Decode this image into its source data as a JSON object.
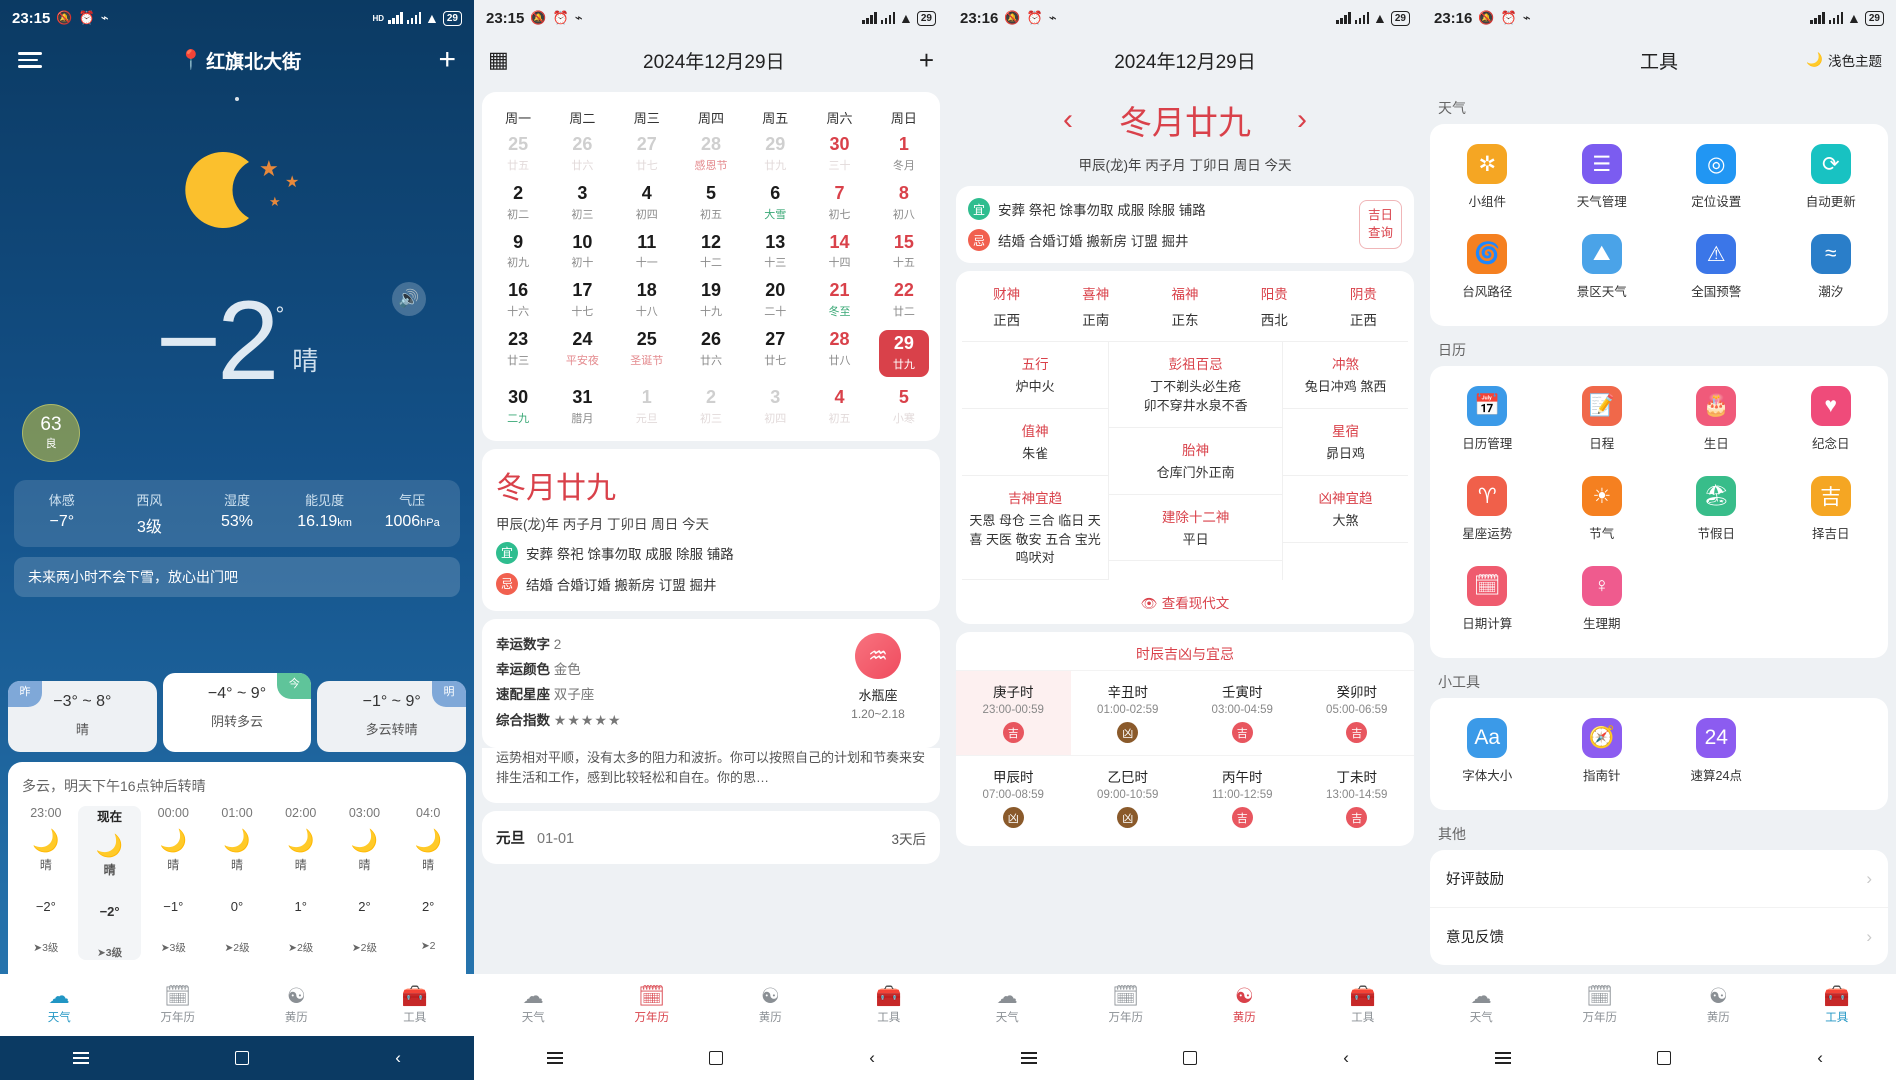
{
  "status_bars": [
    {
      "time": "23:15",
      "icons": [
        "mute-icon",
        "alarm-icon",
        "nfc-icon"
      ],
      "signal": "HD",
      "battery": "29"
    },
    {
      "time": "23:15",
      "icons": [
        "mute-icon",
        "alarm-icon",
        "nfc-icon"
      ],
      "signal": "HD",
      "battery": "29"
    },
    {
      "time": "23:16",
      "icons": [
        "mute-icon",
        "alarm-icon",
        "nfc-icon"
      ],
      "signal": "HD",
      "battery": "29"
    },
    {
      "time": "23:16",
      "icons": [
        "mute-icon",
        "alarm-icon",
        "nfc-icon"
      ],
      "signal": "HD",
      "battery": "29"
    }
  ],
  "weather": {
    "city": "红旗北大街",
    "temp": "−2",
    "degree": "°",
    "condition": "晴",
    "aqi_value": "63",
    "aqi_level": "良",
    "metrics": [
      {
        "key": "体感",
        "value": "−7°"
      },
      {
        "key": "西风",
        "value": "3级"
      },
      {
        "key": "湿度",
        "value": "53%"
      },
      {
        "key": "能见度",
        "value": "16.19",
        "unit": "km"
      },
      {
        "key": "气压",
        "value": "1006",
        "unit": "hPa"
      }
    ],
    "tip": "未来两小时不会下雪，放心出门吧",
    "days": [
      {
        "badge": "昨",
        "badge_color": "#7fa8d8",
        "range": "−3° ~ 8°",
        "desc": "晴",
        "today": false
      },
      {
        "badge": "今",
        "badge_color": "#5fc49a",
        "range": "−4° ~ 9°",
        "desc": "阴转多云",
        "today": true
      },
      {
        "badge": "明",
        "badge_color": "#7fa8d8",
        "range": "−1° ~ 9°",
        "desc": "多云转晴",
        "today": false
      }
    ],
    "hourly_summary": "多云，明天下午16点钟后转晴",
    "hours": [
      {
        "time": "23:00",
        "icon": "moon-icon",
        "desc": "晴",
        "temp": "−2°",
        "wind": "➤3级",
        "now": false
      },
      {
        "time": "现在",
        "icon": "moon-icon",
        "desc": "晴",
        "temp": "−2°",
        "wind": "➤3级",
        "now": true
      },
      {
        "time": "00:00",
        "icon": "moon-icon",
        "desc": "晴",
        "temp": "−1°",
        "wind": "➤3级",
        "now": false
      },
      {
        "time": "01:00",
        "icon": "moon-icon",
        "desc": "晴",
        "temp": "0°",
        "wind": "➤2级",
        "now": false
      },
      {
        "time": "02:00",
        "icon": "moon-icon",
        "desc": "晴",
        "temp": "1°",
        "wind": "➤2级",
        "now": false
      },
      {
        "time": "03:00",
        "icon": "moon-icon",
        "desc": "晴",
        "temp": "2°",
        "wind": "➤2级",
        "now": false
      },
      {
        "time": "04:0",
        "icon": "moon-icon",
        "desc": "晴",
        "temp": "2°",
        "wind": "➤2",
        "now": false
      }
    ]
  },
  "calendar": {
    "title": "2024年12月29日",
    "weekdays": [
      "周一",
      "周二",
      "周三",
      "周四",
      "周五",
      "周六",
      "周日"
    ],
    "weeks": [
      [
        {
          "d": "25",
          "l": "廿五",
          "dim": true
        },
        {
          "d": "26",
          "l": "廿六",
          "dim": true
        },
        {
          "d": "27",
          "l": "廿七",
          "dim": true
        },
        {
          "d": "28",
          "l": "感恩节",
          "dim": true,
          "fest": true
        },
        {
          "d": "29",
          "l": "廿九",
          "dim": true
        },
        {
          "d": "30",
          "l": "三十",
          "dim": true,
          "wknd": true
        },
        {
          "d": "1",
          "l": "冬月",
          "wknd": true
        }
      ],
      [
        {
          "d": "2",
          "l": "初二"
        },
        {
          "d": "3",
          "l": "初三"
        },
        {
          "d": "4",
          "l": "初四"
        },
        {
          "d": "5",
          "l": "初五"
        },
        {
          "d": "6",
          "l": "大雪",
          "term": true
        },
        {
          "d": "7",
          "l": "初七",
          "wknd": true
        },
        {
          "d": "8",
          "l": "初八",
          "wknd": true
        }
      ],
      [
        {
          "d": "9",
          "l": "初九"
        },
        {
          "d": "10",
          "l": "初十"
        },
        {
          "d": "11",
          "l": "十一"
        },
        {
          "d": "12",
          "l": "十二"
        },
        {
          "d": "13",
          "l": "十三"
        },
        {
          "d": "14",
          "l": "十四",
          "wknd": true
        },
        {
          "d": "15",
          "l": "十五",
          "wknd": true
        }
      ],
      [
        {
          "d": "16",
          "l": "十六"
        },
        {
          "d": "17",
          "l": "十七"
        },
        {
          "d": "18",
          "l": "十八"
        },
        {
          "d": "19",
          "l": "十九"
        },
        {
          "d": "20",
          "l": "二十"
        },
        {
          "d": "21",
          "l": "冬至",
          "wknd": true,
          "term": true
        },
        {
          "d": "22",
          "l": "廿二",
          "wknd": true
        }
      ],
      [
        {
          "d": "23",
          "l": "廿三"
        },
        {
          "d": "24",
          "l": "平安夜",
          "fest": true
        },
        {
          "d": "25",
          "l": "圣诞节",
          "fest": true
        },
        {
          "d": "26",
          "l": "廿六"
        },
        {
          "d": "27",
          "l": "廿七"
        },
        {
          "d": "28",
          "l": "廿八",
          "wknd": true
        },
        {
          "d": "29",
          "l": "廿九",
          "wknd": true,
          "sel": true
        }
      ],
      [
        {
          "d": "30",
          "l": "二九",
          "term": true
        },
        {
          "d": "31",
          "l": "腊月"
        },
        {
          "d": "1",
          "l": "元旦",
          "dim": true
        },
        {
          "d": "2",
          "l": "初三",
          "dim": true
        },
        {
          "d": "3",
          "l": "初四",
          "dim": true
        },
        {
          "d": "4",
          "l": "初五",
          "dim": true,
          "wknd": true
        },
        {
          "d": "5",
          "l": "小寒",
          "dim": true,
          "wknd": true
        }
      ]
    ]
  },
  "lunar": {
    "title": "冬月廿九",
    "subtitle": "甲辰(龙)年 丙子月 丁卯日 周日 今天",
    "yi_label": "宜",
    "yi_text": "安葬 祭祀 馀事勿取 成服 除服 铺路",
    "ji_label": "忌",
    "ji_text": "结婚 合婚订婚 搬新房 订盟 掘井",
    "jiri_button": "吉日\n查询"
  },
  "fortune": {
    "lucky_number_label": "幸运数字",
    "lucky_number": "2",
    "lucky_color_label": "幸运颜色",
    "lucky_color": "金色",
    "match_label": "速配星座",
    "match": "双子座",
    "index_label": "综合指数",
    "stars": "★★★★★",
    "sign_name": "水瓶座",
    "sign_icon": "aquarius-icon",
    "sign_dates": "1.20~2.18",
    "text": "运势相对平顺，没有太多的阻力和波折。你可以按照自己的计划和节奏来安排生活和工作，感到比较轻松和自在。你的思…"
  },
  "festival_row": {
    "name": "元旦",
    "date": "01-01",
    "countdown": "3天后"
  },
  "almanac": {
    "header_date": "2024年12月29日",
    "prev_icon": "chevron-left-icon",
    "next_icon": "chevron-right-icon",
    "lunar_title": "冬月廿九",
    "lunar_sub": "甲辰(龙)年 丙子月 丁卯日 周日 今天",
    "deities": [
      {
        "key": "财神",
        "value": "正西"
      },
      {
        "key": "喜神",
        "value": "正南"
      },
      {
        "key": "福神",
        "value": "正东"
      },
      {
        "key": "阳贵",
        "value": "西北"
      },
      {
        "key": "阴贵",
        "value": "正西"
      }
    ],
    "left_cells": [
      {
        "key": "五行",
        "value": "炉中火"
      },
      {
        "key": "值神",
        "value": "朱雀"
      },
      {
        "key": "吉神宜趋",
        "value": "天恩 母仓 三合 临日 天喜 天医 敬安 五合 宝光 鸣吠对"
      }
    ],
    "mid_cells": [
      {
        "key": "彭祖百忌",
        "value": "丁不剃头必生疮\n卯不穿井水泉不香"
      },
      {
        "key": "胎神",
        "value": "仓库门外正南"
      },
      {
        "key": "建除十二神",
        "value": "平日"
      }
    ],
    "right_cells": [
      {
        "key": "冲煞",
        "value": "兔日冲鸡 煞西"
      },
      {
        "key": "星宿",
        "value": "昴日鸡"
      },
      {
        "key": "凶神宜趋",
        "value": "大煞"
      }
    ],
    "view_modern": "查看现代文",
    "view_modern_icon": "eye-icon",
    "hours_title": "时辰吉凶与宜忌",
    "hours": [
      {
        "name": "庚子时",
        "range": "23:00-00:59",
        "mark": "吉",
        "type": "ji",
        "hl": true
      },
      {
        "name": "辛丑时",
        "range": "01:00-02:59",
        "mark": "凶",
        "type": "xiong"
      },
      {
        "name": "壬寅时",
        "range": "03:00-04:59",
        "mark": "吉",
        "type": "ji"
      },
      {
        "name": "癸卯时",
        "range": "05:00-06:59",
        "mark": "吉",
        "type": "ji"
      },
      {
        "name": "甲辰时",
        "range": "07:00-08:59",
        "mark": "凶",
        "type": "xiong"
      },
      {
        "name": "乙巳时",
        "range": "09:00-10:59",
        "mark": "凶",
        "type": "xiong"
      },
      {
        "name": "丙午时",
        "range": "11:00-12:59",
        "mark": "吉",
        "type": "ji"
      },
      {
        "name": "丁未时",
        "range": "13:00-14:59",
        "mark": "吉",
        "type": "ji"
      }
    ]
  },
  "tools": {
    "title": "工具",
    "theme_label": "浅色主题",
    "theme_icon": "moon-icon",
    "sections": [
      {
        "title": "天气",
        "items": [
          {
            "label": "小组件",
            "icon": "puzzle-icon",
            "color": "#f5a623"
          },
          {
            "label": "天气管理",
            "icon": "list-icon",
            "color": "#7b5cf0"
          },
          {
            "label": "定位设置",
            "icon": "location-icon",
            "color": "#2196f3"
          },
          {
            "label": "自动更新",
            "icon": "refresh-icon",
            "color": "#18c2c2"
          },
          {
            "label": "台风路径",
            "icon": "typhoon-icon",
            "color": "#f58020"
          },
          {
            "label": "景区天气",
            "icon": "scenic-icon",
            "color": "#4aa3e8"
          },
          {
            "label": "全国预警",
            "icon": "warning-icon",
            "color": "#3b76e8"
          },
          {
            "label": "潮汐",
            "icon": "tide-icon",
            "color": "#2a7ec9"
          }
        ]
      },
      {
        "title": "日历",
        "items": [
          {
            "label": "日历管理",
            "icon": "calendar-icon",
            "color": "#3b9ae8"
          },
          {
            "label": "日程",
            "icon": "schedule-icon",
            "color": "#f0684a"
          },
          {
            "label": "生日",
            "icon": "cake-icon",
            "color": "#f05a7a"
          },
          {
            "label": "纪念日",
            "icon": "heart-icon",
            "color": "#ef4b7a"
          },
          {
            "label": "星座运势",
            "icon": "zodiac-icon",
            "color": "#f0604a"
          },
          {
            "label": "节气",
            "icon": "solarterm-icon",
            "color": "#f58020"
          },
          {
            "label": "节假日",
            "icon": "holiday-icon",
            "color": "#38bd8a"
          },
          {
            "label": "择吉日",
            "icon": "luckyday-icon",
            "color": "#f5a623"
          },
          {
            "label": "日期计算",
            "icon": "datecalc-icon",
            "color": "#ef5b6e"
          },
          {
            "label": "生理期",
            "icon": "period-icon",
            "color": "#ef5b8e"
          }
        ]
      },
      {
        "title": "小工具",
        "items": [
          {
            "label": "字体大小",
            "icon": "fontsize-icon",
            "color": "#3b9ae8"
          },
          {
            "label": "指南针",
            "icon": "compass-icon",
            "color": "#8c5cf0"
          },
          {
            "label": "速算24点",
            "icon": "calc24-icon",
            "color": "#8c5cf0"
          }
        ]
      }
    ],
    "other_title": "其他",
    "other_items": [
      {
        "label": "好评鼓励"
      },
      {
        "label": "意见反馈"
      }
    ]
  },
  "tabbar": {
    "items": [
      {
        "label": "天气",
        "icon": "cloud-icon"
      },
      {
        "label": "万年历",
        "icon": "calendar-icon"
      },
      {
        "label": "黄历",
        "icon": "yinyang-icon"
      },
      {
        "label": "工具",
        "icon": "toolbox-icon"
      }
    ],
    "active": [
      0,
      1,
      2,
      3
    ]
  },
  "navbar": {
    "menu": "menu-icon",
    "home": "home-icon",
    "back": "back-icon"
  }
}
